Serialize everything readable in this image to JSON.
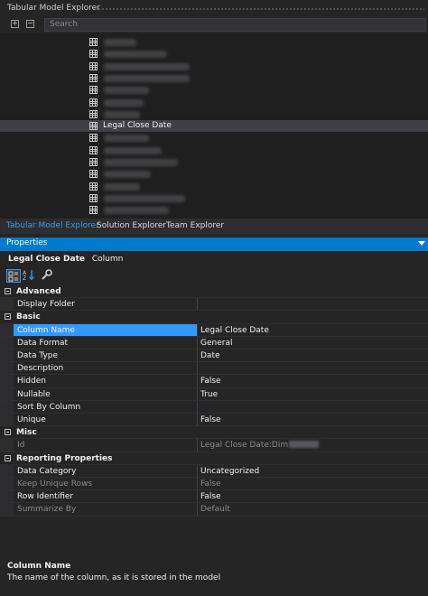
{
  "explorer": {
    "title": "Tabular Model Explorer",
    "search_placeholder": "Search",
    "expand_label": "+",
    "collapse_label": "−",
    "tree": {
      "selected_label": "Legal Close Date",
      "redacted_item_count": 15
    }
  },
  "tabs": [
    "Tabular Model Explorer",
    "Solution Explorer",
    "Team Explorer"
  ],
  "properties": {
    "title": "Properties",
    "object_name": "Legal Close Date",
    "object_type": "Column",
    "categories": [
      {
        "name": "Advanced",
        "rows": [
          {
            "name": "Display Folder",
            "value": ""
          }
        ]
      },
      {
        "name": "Basic",
        "rows": [
          {
            "name": "Column Name",
            "value": "Legal Close Date"
          },
          {
            "name": "Data Format",
            "value": "General"
          },
          {
            "name": "Data Type",
            "value": "Date"
          },
          {
            "name": "Description",
            "value": ""
          },
          {
            "name": "Hidden",
            "value": "False"
          },
          {
            "name": "Nullable",
            "value": "True"
          },
          {
            "name": "Sort By Column",
            "value": ""
          },
          {
            "name": "Unique",
            "value": "False"
          }
        ]
      },
      {
        "name": "Misc",
        "rows": [
          {
            "name": "Id",
            "value": "Legal Close Date:Dim"
          }
        ]
      },
      {
        "name": "Reporting Properties",
        "rows": [
          {
            "name": "Data Category",
            "value": "Uncategorized"
          },
          {
            "name": "Keep Unique Rows",
            "value": "False"
          },
          {
            "name": "Row Identifier",
            "value": "False"
          },
          {
            "name": "Summarize By",
            "value": "Default"
          }
        ]
      }
    ],
    "description_title": "Column Name",
    "description_text": "The name of the column, as it is stored in the model"
  }
}
